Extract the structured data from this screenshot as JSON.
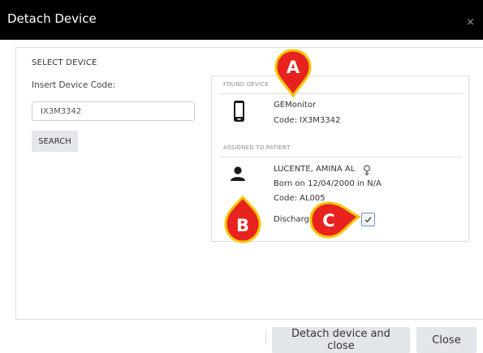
{
  "dialog": {
    "title": "Detach Device",
    "close_glyph": "×"
  },
  "select_device": {
    "heading": "SELECT DEVICE",
    "insert_label": "Insert Device Code:",
    "code_value": "IX3M3342",
    "search_label": "SEARCH"
  },
  "found_device": {
    "heading": "FOUND DEVICE",
    "name": "GEMonitor",
    "code": "Code: IX3M3342",
    "icon": "phone-icon"
  },
  "assigned_patient": {
    "heading": "ASSIGNED TO PATIENT",
    "name": "LUCENTE, AMINA AL",
    "gender_icon": "female-icon",
    "born": "Born on 12/04/2000 in N/A",
    "code": "Code: AL005",
    "discharge_label": "Discharge",
    "discharge_checked": true,
    "icon": "person-icon"
  },
  "footer": {
    "detach_label": "Detach device and close",
    "close_label": "Close"
  },
  "callouts": {
    "a": "A",
    "b": "B",
    "c": "C",
    "fill_color": "#e8231f",
    "outline_color": "#f5c400"
  }
}
